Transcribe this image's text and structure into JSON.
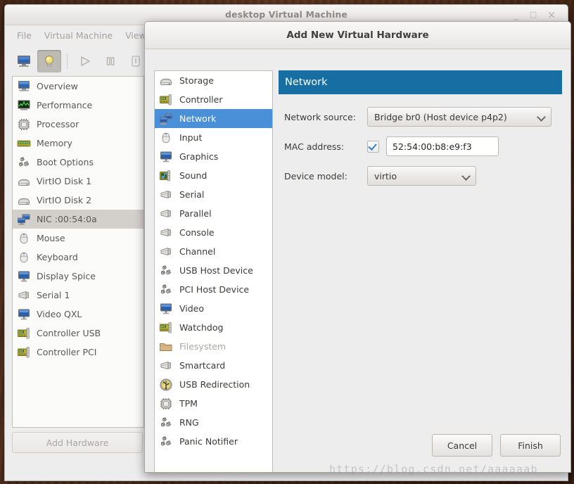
{
  "desktop": {
    "watermark": "https://blog.csdn.net/aaaaaab"
  },
  "main_window": {
    "title": "desktop Virtual Machine",
    "controls": {
      "minimize": "_",
      "maximize": "□",
      "close": "×"
    },
    "menus": [
      "File",
      "Virtual Machine",
      "View"
    ],
    "toolbar": [
      {
        "name": "console-view-icon",
        "label": "Console view",
        "pressed": false
      },
      {
        "name": "details-view-icon",
        "label": "Details view",
        "pressed": true
      },
      {
        "name": "run-icon",
        "label": "Run",
        "pressed": false
      },
      {
        "name": "pause-icon",
        "label": "Pause",
        "pressed": false
      },
      {
        "name": "shutdown-icon",
        "label": "Shut Down",
        "pressed": false
      }
    ],
    "hardware_list": [
      {
        "label": "Overview",
        "icon": "monitor-icon",
        "selected": false
      },
      {
        "label": "Performance",
        "icon": "graph-icon",
        "selected": false
      },
      {
        "label": "Processor",
        "icon": "cpu-icon",
        "selected": false
      },
      {
        "label": "Memory",
        "icon": "memory-icon",
        "selected": false
      },
      {
        "label": "Boot Options",
        "icon": "gears-icon",
        "selected": false
      },
      {
        "label": "VirtIO Disk 1",
        "icon": "disk-icon",
        "selected": false
      },
      {
        "label": "VirtIO Disk 2",
        "icon": "disk-icon",
        "selected": false
      },
      {
        "label": "NIC :00:54:0a",
        "icon": "network-icon",
        "selected": true
      },
      {
        "label": "Mouse",
        "icon": "mouse-icon",
        "selected": false
      },
      {
        "label": "Keyboard",
        "icon": "mouse-icon",
        "selected": false
      },
      {
        "label": "Display Spice",
        "icon": "display-icon",
        "selected": false
      },
      {
        "label": "Serial 1",
        "icon": "serial-icon",
        "selected": false
      },
      {
        "label": "Video QXL",
        "icon": "display-icon",
        "selected": false
      },
      {
        "label": "Controller USB",
        "icon": "controller-icon",
        "selected": false
      },
      {
        "label": "Controller PCI",
        "icon": "controller-icon",
        "selected": false
      }
    ],
    "add_hardware_label": "Add Hardware"
  },
  "dialog": {
    "title": "Add New Virtual Hardware",
    "device_list": [
      {
        "label": "Storage",
        "icon": "disk-icon",
        "selected": false,
        "disabled": false
      },
      {
        "label": "Controller",
        "icon": "controller-icon",
        "selected": false,
        "disabled": false
      },
      {
        "label": "Network",
        "icon": "network-icon",
        "selected": true,
        "disabled": false
      },
      {
        "label": "Input",
        "icon": "mouse-icon",
        "selected": false,
        "disabled": false
      },
      {
        "label": "Graphics",
        "icon": "display-icon",
        "selected": false,
        "disabled": false
      },
      {
        "label": "Sound",
        "icon": "sound-icon",
        "selected": false,
        "disabled": false
      },
      {
        "label": "Serial",
        "icon": "serial-icon",
        "selected": false,
        "disabled": false
      },
      {
        "label": "Parallel",
        "icon": "serial-icon",
        "selected": false,
        "disabled": false
      },
      {
        "label": "Console",
        "icon": "serial-icon",
        "selected": false,
        "disabled": false
      },
      {
        "label": "Channel",
        "icon": "serial-icon",
        "selected": false,
        "disabled": false
      },
      {
        "label": "USB Host Device",
        "icon": "gears-icon",
        "selected": false,
        "disabled": false
      },
      {
        "label": "PCI Host Device",
        "icon": "gears-icon",
        "selected": false,
        "disabled": false
      },
      {
        "label": "Video",
        "icon": "display-icon",
        "selected": false,
        "disabled": false
      },
      {
        "label": "Watchdog",
        "icon": "controller-icon",
        "selected": false,
        "disabled": false
      },
      {
        "label": "Filesystem",
        "icon": "folder-icon",
        "selected": false,
        "disabled": true
      },
      {
        "label": "Smartcard",
        "icon": "serial-icon",
        "selected": false,
        "disabled": false
      },
      {
        "label": "USB Redirection",
        "icon": "usb-icon",
        "selected": false,
        "disabled": false
      },
      {
        "label": "TPM",
        "icon": "cpu-icon",
        "selected": false,
        "disabled": false
      },
      {
        "label": "RNG",
        "icon": "gears-icon",
        "selected": false,
        "disabled": false
      },
      {
        "label": "Panic Notifier",
        "icon": "gears-icon",
        "selected": false,
        "disabled": false
      }
    ],
    "pane": {
      "header": "Network",
      "fields": {
        "network_source": {
          "label": "Network source:",
          "value": "Bridge br0 (Host device p4p2)"
        },
        "mac_address": {
          "label": "MAC address:",
          "checked": true,
          "value": "52:54:00:b8:e9:f3"
        },
        "device_model": {
          "label": "Device model:",
          "value": "virtio"
        }
      }
    },
    "buttons": {
      "cancel": "Cancel",
      "finish": "Finish"
    }
  },
  "colors": {
    "pane_header_blue": "#166ea3",
    "selection_blue": "#4a90d9",
    "window_chrome": "#ededed",
    "desktop": "#5c3420"
  }
}
